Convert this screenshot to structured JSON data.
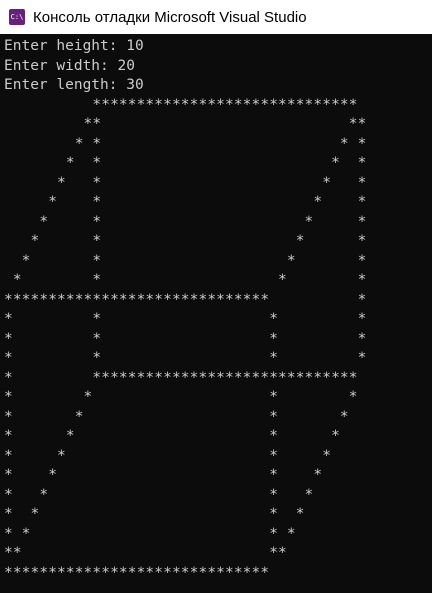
{
  "window": {
    "title": "Консоль отладки Microsoft Visual Studio",
    "icon": "console-app-icon",
    "icon_glyph": "C:\\",
    "accent": "#68217a"
  },
  "console": {
    "prompts": [
      "Enter height: 10",
      "Enter width: 20",
      "Enter length: 30"
    ],
    "output": [
      "          ******************************",
      "         **                            **",
      "        * *                           * *",
      "       *  *                          *  *",
      "      *   *                         *   *",
      "     *    *                        *    *",
      "    *     *                       *     *",
      "   *      *                      *      *",
      "  *       *                     *       *",
      " *        *                    *        *",
      "******************************          *",
      "*         *                   *         *",
      "*         *                   *         *",
      "*         *                   *         *",
      "*         ******************************",
      "*        *                    *        *",
      "*       *                     *       *",
      "*      *                      *      *",
      "*     *                       *     *",
      "*    *                        *    *",
      "*   *                         *   *",
      "*  *                          *  *",
      "* *                           * *",
      "**                            **",
      "******************************"
    ]
  }
}
